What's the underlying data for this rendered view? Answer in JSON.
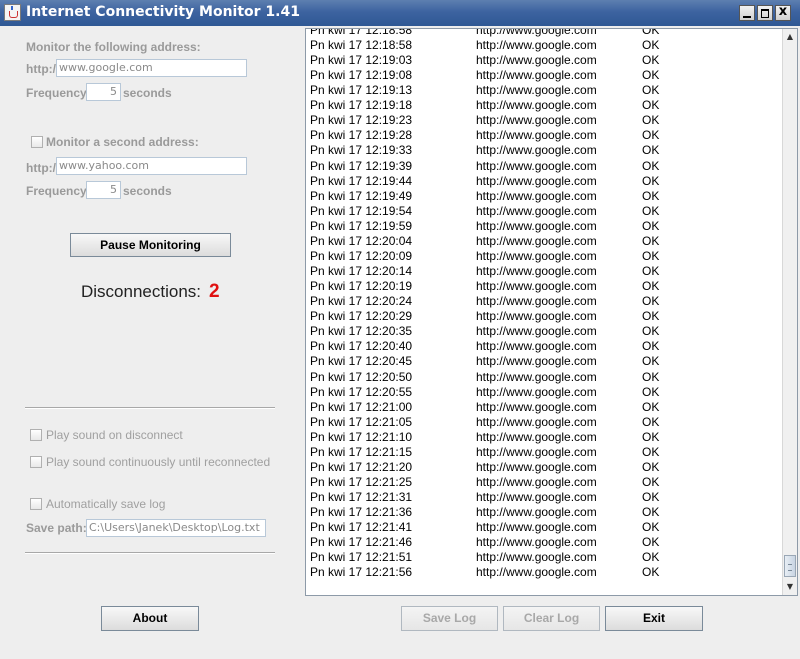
{
  "window": {
    "title": "Internet Connectivity Monitor 1.41",
    "close_glyph": "x"
  },
  "monitor1": {
    "label": "Monitor the following address:",
    "prefix": "http://",
    "address": "www.google.com",
    "freq_label": "Frequency:",
    "freq_value": "5",
    "freq_unit": "seconds"
  },
  "monitor2": {
    "label": "Monitor a second address:",
    "checked": false,
    "prefix": "http://",
    "address": "www.yahoo.com",
    "freq_label": "Frequency:",
    "freq_value": "5",
    "freq_unit": "seconds"
  },
  "pause_label": "Pause Monitoring",
  "disconnections": {
    "label": "Disconnections:",
    "count": "2"
  },
  "options": {
    "sound_disconnect": "Play sound on disconnect",
    "sound_continuous": "Play sound continuously until reconnected",
    "auto_save": "Automatically save log",
    "save_path_label": "Save path:",
    "save_path": "C:\\Users\\Janek\\Desktop\\Log.txt"
  },
  "buttons": {
    "about": "About",
    "save_log": "Save Log",
    "clear_log": "Clear Log",
    "exit": "Exit"
  },
  "colors": {
    "title_bar": "#3d63a0",
    "disconnection_count": "#e01010"
  },
  "log": {
    "rows": [
      {
        "time": "Pn kwi 17 12:18:58",
        "url": "http://www.google.com",
        "status": "OK"
      },
      {
        "time": "Pn kwi 17 12:19:03",
        "url": "http://www.google.com",
        "status": "OK"
      },
      {
        "time": "Pn kwi 17 12:19:08",
        "url": "http://www.google.com",
        "status": "OK"
      },
      {
        "time": "Pn kwi 17 12:19:13",
        "url": "http://www.google.com",
        "status": "OK"
      },
      {
        "time": "Pn kwi 17 12:19:18",
        "url": "http://www.google.com",
        "status": "OK"
      },
      {
        "time": "Pn kwi 17 12:19:23",
        "url": "http://www.google.com",
        "status": "OK"
      },
      {
        "time": "Pn kwi 17 12:19:28",
        "url": "http://www.google.com",
        "status": "OK"
      },
      {
        "time": "Pn kwi 17 12:19:33",
        "url": "http://www.google.com",
        "status": "OK"
      },
      {
        "time": "Pn kwi 17 12:19:39",
        "url": "http://www.google.com",
        "status": "OK"
      },
      {
        "time": "Pn kwi 17 12:19:44",
        "url": "http://www.google.com",
        "status": "OK"
      },
      {
        "time": "Pn kwi 17 12:19:49",
        "url": "http://www.google.com",
        "status": "OK"
      },
      {
        "time": "Pn kwi 17 12:19:54",
        "url": "http://www.google.com",
        "status": "OK"
      },
      {
        "time": "Pn kwi 17 12:19:59",
        "url": "http://www.google.com",
        "status": "OK"
      },
      {
        "time": "Pn kwi 17 12:20:04",
        "url": "http://www.google.com",
        "status": "OK"
      },
      {
        "time": "Pn kwi 17 12:20:09",
        "url": "http://www.google.com",
        "status": "OK"
      },
      {
        "time": "Pn kwi 17 12:20:14",
        "url": "http://www.google.com",
        "status": "OK"
      },
      {
        "time": "Pn kwi 17 12:20:19",
        "url": "http://www.google.com",
        "status": "OK"
      },
      {
        "time": "Pn kwi 17 12:20:24",
        "url": "http://www.google.com",
        "status": "OK"
      },
      {
        "time": "Pn kwi 17 12:20:29",
        "url": "http://www.google.com",
        "status": "OK"
      },
      {
        "time": "Pn kwi 17 12:20:35",
        "url": "http://www.google.com",
        "status": "OK"
      },
      {
        "time": "Pn kwi 17 12:20:40",
        "url": "http://www.google.com",
        "status": "OK"
      },
      {
        "time": "Pn kwi 17 12:20:45",
        "url": "http://www.google.com",
        "status": "OK"
      },
      {
        "time": "Pn kwi 17 12:20:50",
        "url": "http://www.google.com",
        "status": "OK"
      },
      {
        "time": "Pn kwi 17 12:20:55",
        "url": "http://www.google.com",
        "status": "OK"
      },
      {
        "time": "Pn kwi 17 12:21:00",
        "url": "http://www.google.com",
        "status": "OK"
      },
      {
        "time": "Pn kwi 17 12:21:05",
        "url": "http://www.google.com",
        "status": "OK"
      },
      {
        "time": "Pn kwi 17 12:21:10",
        "url": "http://www.google.com",
        "status": "OK"
      },
      {
        "time": "Pn kwi 17 12:21:15",
        "url": "http://www.google.com",
        "status": "OK"
      },
      {
        "time": "Pn kwi 17 12:21:20",
        "url": "http://www.google.com",
        "status": "OK"
      },
      {
        "time": "Pn kwi 17 12:21:25",
        "url": "http://www.google.com",
        "status": "OK"
      },
      {
        "time": "Pn kwi 17 12:21:31",
        "url": "http://www.google.com",
        "status": "OK"
      },
      {
        "time": "Pn kwi 17 12:21:36",
        "url": "http://www.google.com",
        "status": "OK"
      },
      {
        "time": "Pn kwi 17 12:21:41",
        "url": "http://www.google.com",
        "status": "OK"
      },
      {
        "time": "Pn kwi 17 12:21:46",
        "url": "http://www.google.com",
        "status": "OK"
      },
      {
        "time": "Pn kwi 17 12:21:51",
        "url": "http://www.google.com",
        "status": "OK"
      },
      {
        "time": "Pn kwi 17 12:21:56",
        "url": "http://www.google.com",
        "status": "OK"
      }
    ]
  }
}
